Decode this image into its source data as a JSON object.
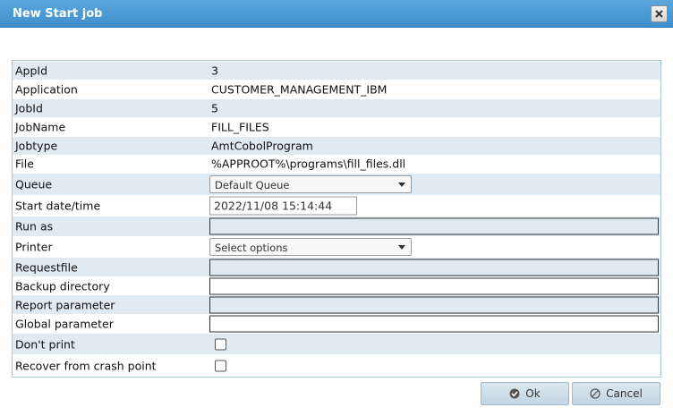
{
  "dialog": {
    "title": "New Start job"
  },
  "fields": {
    "appid": {
      "label": "AppId",
      "value": "3"
    },
    "application": {
      "label": "Application",
      "value": "CUSTOMER_MANAGEMENT_IBM"
    },
    "jobid": {
      "label": "JobId",
      "value": "5"
    },
    "jobname": {
      "label": "JobName",
      "value": "FILL_FILES"
    },
    "jobtype": {
      "label": "Jobtype",
      "value": "AmtCobolProgram"
    },
    "file": {
      "label": "File",
      "value": "%APPROOT%\\programs\\fill_files.dll"
    },
    "queue": {
      "label": "Queue",
      "selected": "Default Queue"
    },
    "start_datetime": {
      "label": "Start date/time",
      "value": "2022/11/08 15:14:44"
    },
    "run_as": {
      "label": "Run as",
      "value": ""
    },
    "printer": {
      "label": "Printer",
      "selected": "Select options"
    },
    "requestfile": {
      "label": "Requestfile",
      "value": ""
    },
    "backup_directory": {
      "label": "Backup directory",
      "value": ""
    },
    "report_parameter": {
      "label": "Report parameter",
      "value": ""
    },
    "global_parameter": {
      "label": "Global parameter",
      "value": ""
    },
    "dont_print": {
      "label": "Don't print",
      "checked": false
    },
    "recover": {
      "label": "Recover from crash point",
      "checked": false
    }
  },
  "buttons": {
    "ok": "Ok",
    "cancel": "Cancel"
  },
  "icons": {
    "close": "close-icon",
    "ok": "check-circle-icon",
    "cancel": "no-entry-icon"
  },
  "colors": {
    "titlebar": "#4a9bd6",
    "row_shade": "#dfeaf2",
    "button_bg": "#cfdeea"
  }
}
